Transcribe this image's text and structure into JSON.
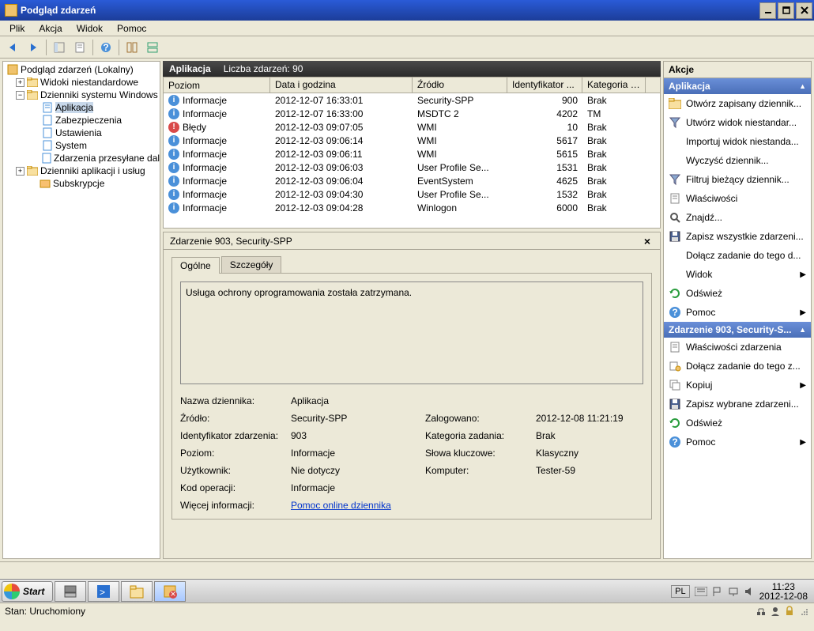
{
  "window": {
    "title": "Podgląd zdarzeń"
  },
  "menu": {
    "file": "Plik",
    "action": "Akcja",
    "view": "Widok",
    "help": "Pomoc"
  },
  "tree": {
    "root": "Podgląd zdarzeń (Lokalny)",
    "custom_views": "Widoki niestandardowe",
    "windows_logs": "Dzienniki systemu Windows",
    "application": "Aplikacja",
    "security": "Zabezpieczenia",
    "setup": "Ustawienia",
    "system": "System",
    "forwarded": "Zdarzenia przesyłane dalej",
    "app_services": "Dzienniki aplikacji i usług",
    "subscriptions": "Subskrypcje"
  },
  "list": {
    "title": "Aplikacja",
    "count_label": "Liczba zdarzeń: 90",
    "cols": {
      "level": "Poziom",
      "date": "Data i godzina",
      "source": "Źródło",
      "id": "Identyfikator ...",
      "cat": "Kategoria zad..."
    },
    "rows": [
      {
        "level": "Informacje",
        "icon": "info",
        "date": "2012-12-07 16:33:01",
        "source": "Security-SPP",
        "id": "900",
        "cat": "Brak"
      },
      {
        "level": "Informacje",
        "icon": "info",
        "date": "2012-12-07 16:33:00",
        "source": "MSDTC 2",
        "id": "4202",
        "cat": "TM"
      },
      {
        "level": "Błędy",
        "icon": "error",
        "date": "2012-12-03 09:07:05",
        "source": "WMI",
        "id": "10",
        "cat": "Brak"
      },
      {
        "level": "Informacje",
        "icon": "info",
        "date": "2012-12-03 09:06:14",
        "source": "WMI",
        "id": "5617",
        "cat": "Brak"
      },
      {
        "level": "Informacje",
        "icon": "info",
        "date": "2012-12-03 09:06:11",
        "source": "WMI",
        "id": "5615",
        "cat": "Brak"
      },
      {
        "level": "Informacje",
        "icon": "info",
        "date": "2012-12-03 09:06:03",
        "source": "User Profile Se...",
        "id": "1531",
        "cat": "Brak"
      },
      {
        "level": "Informacje",
        "icon": "info",
        "date": "2012-12-03 09:06:04",
        "source": "EventSystem",
        "id": "4625",
        "cat": "Brak"
      },
      {
        "level": "Informacje",
        "icon": "info",
        "date": "2012-12-03 09:04:30",
        "source": "User Profile Se...",
        "id": "1532",
        "cat": "Brak"
      },
      {
        "level": "Informacje",
        "icon": "info",
        "date": "2012-12-03 09:04:28",
        "source": "Winlogon",
        "id": "6000",
        "cat": "Brak"
      }
    ]
  },
  "detail": {
    "title": "Zdarzenie 903, Security-SPP",
    "tab_general": "Ogólne",
    "tab_details": "Szczegóły",
    "message": "Usługa ochrony oprogramowania została zatrzymana.",
    "labels": {
      "log_name": "Nazwa dziennika:",
      "source": "Źródło:",
      "event_id": "Identyfikator zdarzenia:",
      "level": "Poziom:",
      "user": "Użytkownik:",
      "opcode": "Kod operacji:",
      "more_info": "Więcej informacji:",
      "logged": "Zalogowano:",
      "task_cat": "Kategoria zadania:",
      "keywords": "Słowa kluczowe:",
      "computer": "Komputer:"
    },
    "values": {
      "log_name": "Aplikacja",
      "source": "Security-SPP",
      "event_id": "903",
      "level": "Informacje",
      "user": "Nie dotyczy",
      "opcode": "Informacje",
      "logged": "2012-12-08 11:21:19",
      "task_cat": "Brak",
      "keywords": "Klasyczny",
      "computer": "Tester-59",
      "help_link": "Pomoc online dziennika"
    }
  },
  "actions": {
    "title": "Akcje",
    "section1": "Aplikacja",
    "items1": [
      {
        "label": "Otwórz zapisany dziennik...",
        "icon": "folder",
        "arrow": false
      },
      {
        "label": "Utwórz widok niestandar...",
        "icon": "filter",
        "arrow": false
      },
      {
        "label": "Importuj widok niestanda...",
        "icon": "",
        "arrow": false
      },
      {
        "label": "Wyczyść dziennik...",
        "icon": "",
        "arrow": false
      },
      {
        "label": "Filtruj bieżący dziennik...",
        "icon": "filter",
        "arrow": false
      },
      {
        "label": "Właściwości",
        "icon": "props",
        "arrow": false
      },
      {
        "label": "Znajdź...",
        "icon": "find",
        "arrow": false
      },
      {
        "label": "Zapisz wszystkie zdarzeni...",
        "icon": "save",
        "arrow": false
      },
      {
        "label": "Dołącz zadanie do tego d...",
        "icon": "",
        "arrow": false
      },
      {
        "label": "Widok",
        "icon": "",
        "arrow": true
      },
      {
        "label": "Odśwież",
        "icon": "refresh",
        "arrow": false
      },
      {
        "label": "Pomoc",
        "icon": "help",
        "arrow": true
      }
    ],
    "section2": "Zdarzenie 903, Security-S...",
    "items2": [
      {
        "label": "Właściwości zdarzenia",
        "icon": "props",
        "arrow": false
      },
      {
        "label": "Dołącz zadanie do tego z...",
        "icon": "attach",
        "arrow": false
      },
      {
        "label": "Kopiuj",
        "icon": "copy",
        "arrow": true
      },
      {
        "label": "Zapisz wybrane zdarzeni...",
        "icon": "save",
        "arrow": false
      },
      {
        "label": "Odśwież",
        "icon": "refresh",
        "arrow": false
      },
      {
        "label": "Pomoc",
        "icon": "help",
        "arrow": true
      }
    ]
  },
  "taskbar": {
    "start": "Start",
    "lang": "PL",
    "time": "11:23",
    "date": "2012-12-08"
  },
  "status": {
    "text": "Stan: Uruchomiony"
  }
}
